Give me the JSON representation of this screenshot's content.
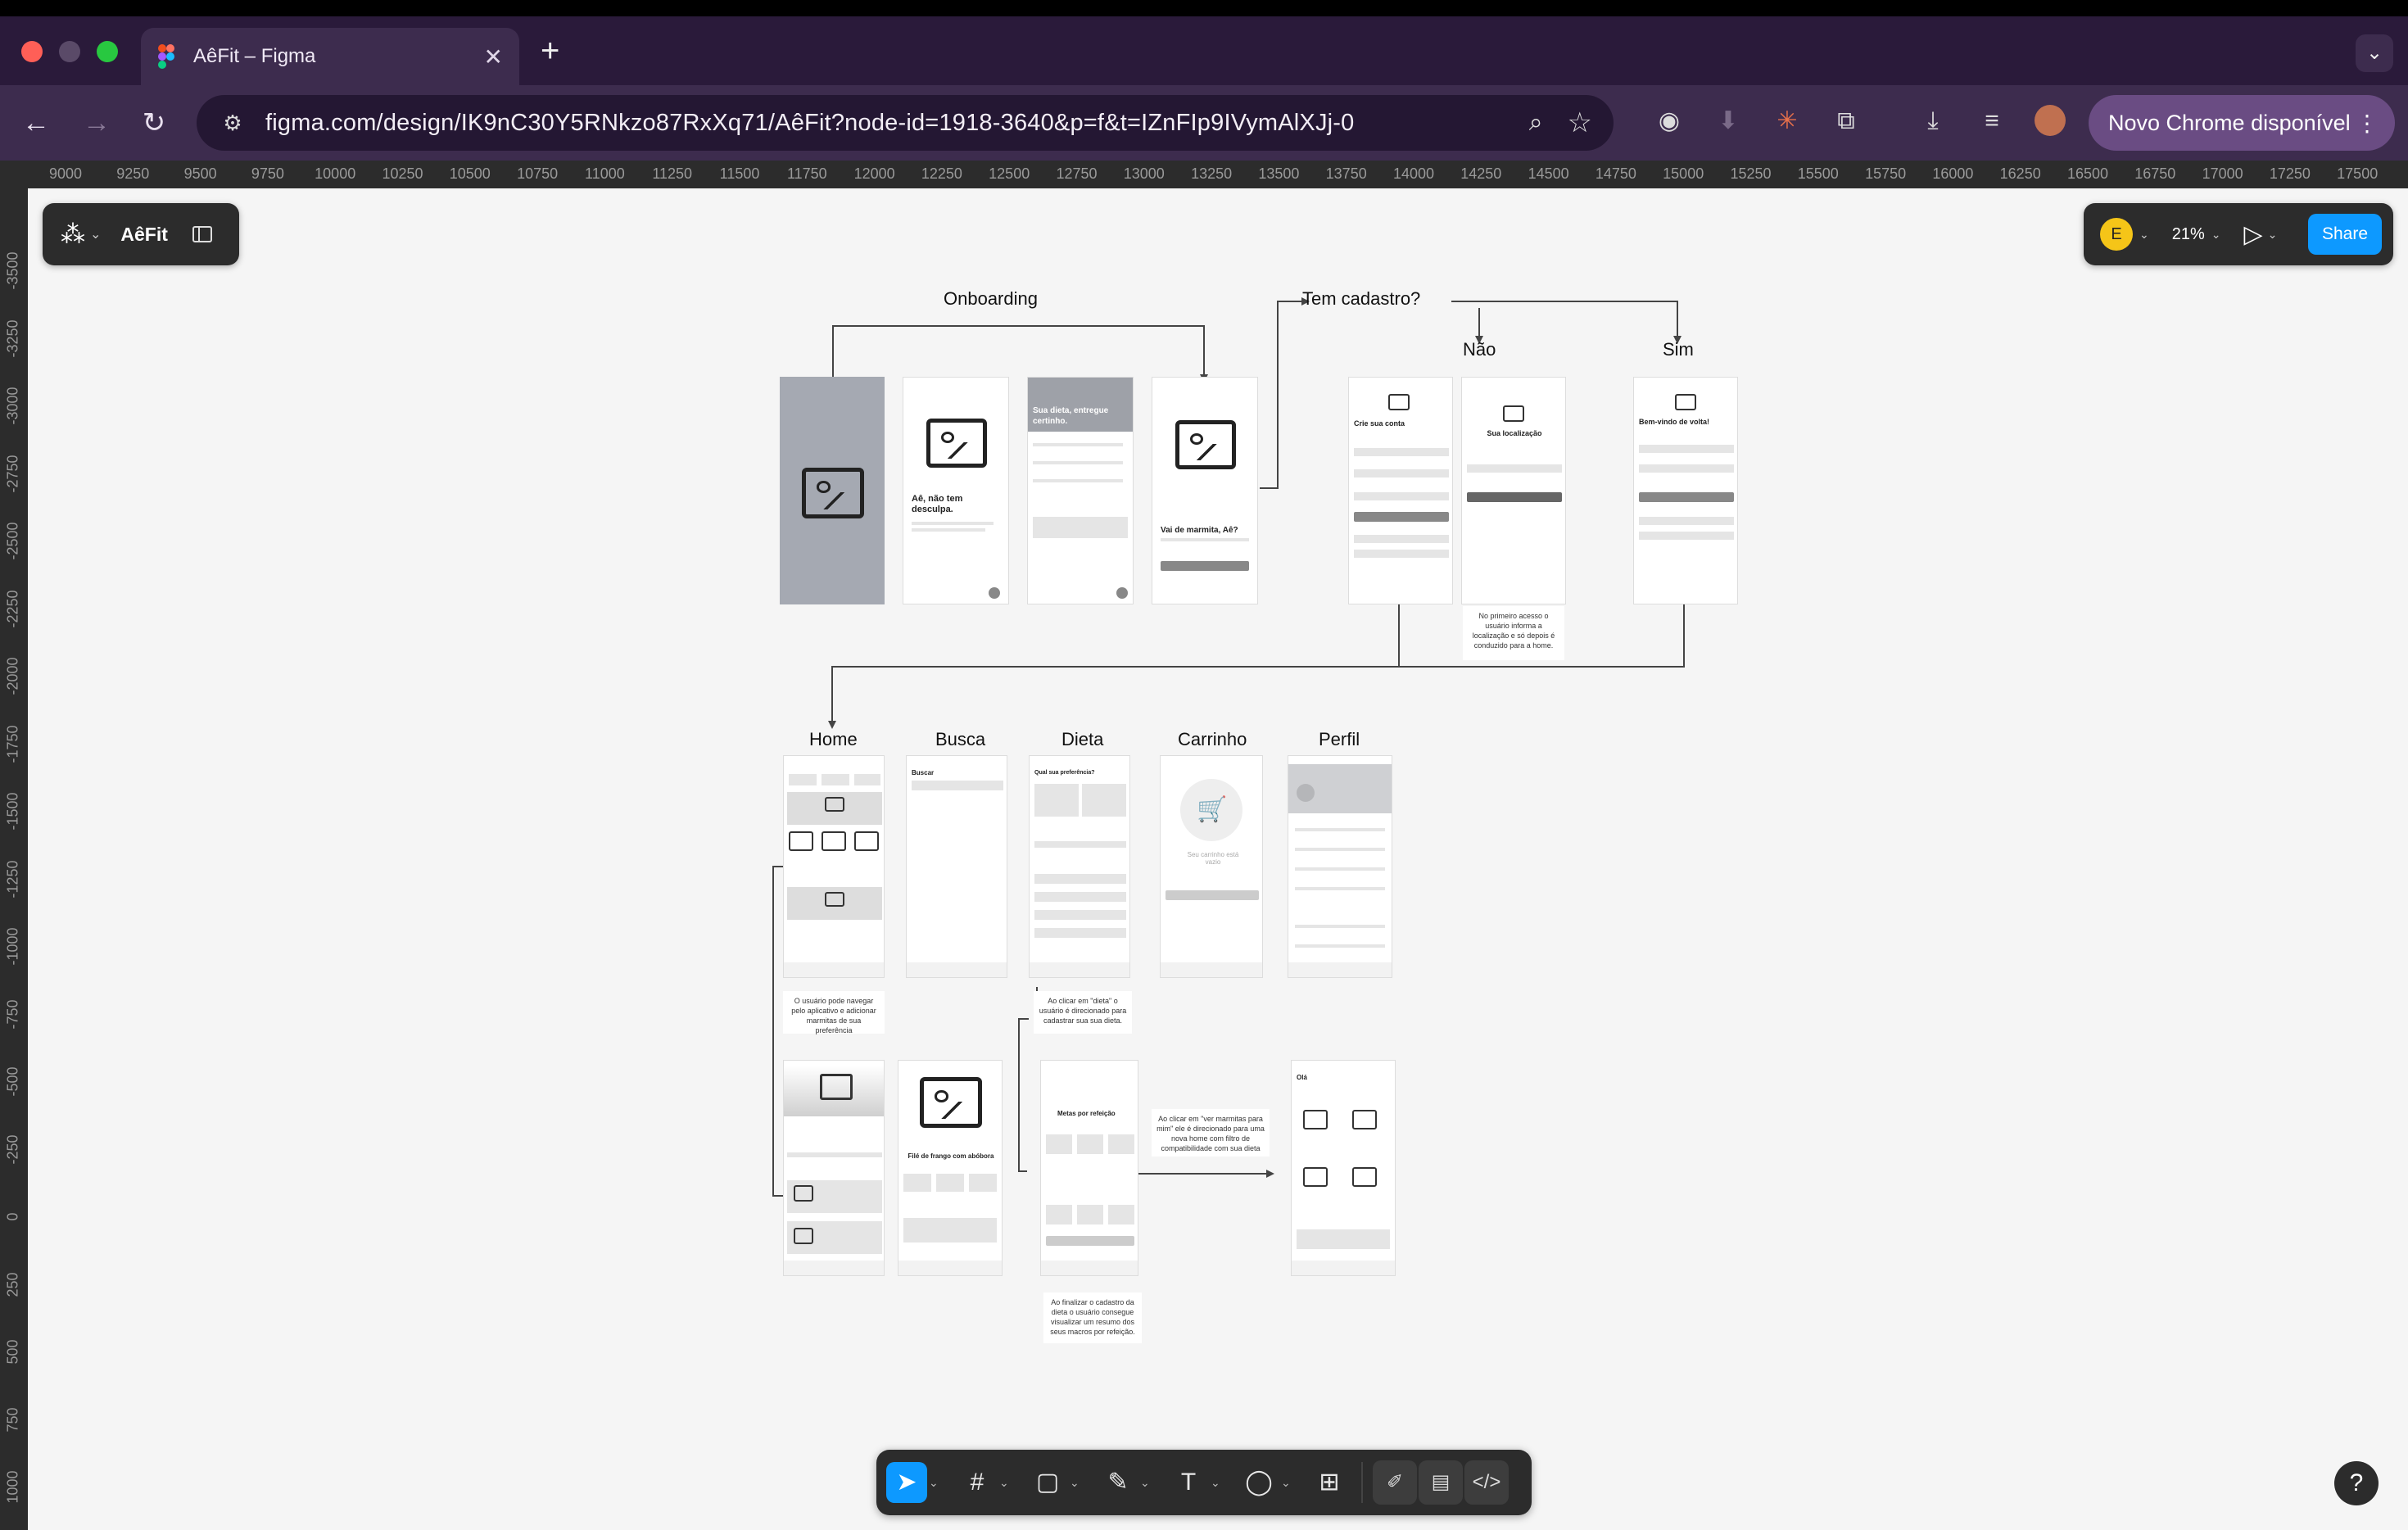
{
  "browser": {
    "tab_title": "AêFit – Figma",
    "url": "figma.com/design/IK9nC30Y5RNkzo87RxXq71/AêFit?node-id=1918-3640&p=f&t=IZnFIp9IVymAlXJj-0",
    "update_label": "Novo Chrome disponível"
  },
  "ruler": {
    "horizontal": [
      "9000",
      "9250",
      "9500",
      "9750",
      "10000",
      "10250",
      "10500",
      "10750",
      "11000",
      "11250",
      "11500",
      "11750",
      "12000",
      "12250",
      "12500",
      "12750",
      "13000",
      "13250",
      "13500",
      "13750",
      "14000",
      "14250",
      "14500",
      "14750",
      "15000",
      "15250",
      "15500",
      "15750",
      "16000",
      "16250",
      "16500",
      "16750",
      "17000",
      "17250",
      "17500"
    ],
    "vertical": [
      "-3500",
      "-3250",
      "-3000",
      "-2750",
      "-2500",
      "-2250",
      "-2000",
      "-1750",
      "-1500",
      "-1250",
      "-1000",
      "-750",
      "-500",
      "-250",
      "0",
      "250",
      "500",
      "750",
      "1000"
    ]
  },
  "figma": {
    "project_name": "AêFit",
    "user_initial": "E",
    "zoom": "21%",
    "share_label": "Share",
    "help_label": "?"
  },
  "flow": {
    "onboarding": "Onboarding",
    "tem_cadastro": "Tem cadastro?",
    "nao": "Não",
    "sim": "Sim",
    "home": "Home",
    "busca": "Busca",
    "dieta": "Dieta",
    "carrinho": "Carrinho",
    "perfil": "Perfil"
  },
  "screens": {
    "onb2_title": "Aê, não tem desculpa.",
    "onb3_title": "Sua dieta, entregue certinho.",
    "onb4_title": "Vai de marmita, Aê?",
    "crie_conta": "Crie sua conta",
    "localizacao": "Sua localização",
    "bem_vindo": "Bem-vindo de volta!",
    "buscar": "Buscar",
    "dieta_pref": "Qual sua preferência?",
    "carrinho_vazio": "Seu carrinho está vazio",
    "file_frango": "Filé de frango com abóbora",
    "metas": "Metas por refeição",
    "ola": "Olá"
  },
  "notes": {
    "localizacao": "No primeiro acesso o usuário informa a localização e só depois é conduzido para a home.",
    "home": "O usuário pode navegar pelo aplicativo e adicionar marmitas de sua preferência",
    "dieta": "Ao clicar em \"dieta\" o usuário é direcionado para cadastrar sua sua dieta.",
    "marmitas": "Ao clicar em \"ver marmitas para mim\" ele é direcionado para uma nova home com filtro de compatibilidade com sua dieta",
    "finalizar": "Ao finalizar o cadastro da dieta o usuário consegue visualizar um resumo dos seus macros por refeição."
  }
}
